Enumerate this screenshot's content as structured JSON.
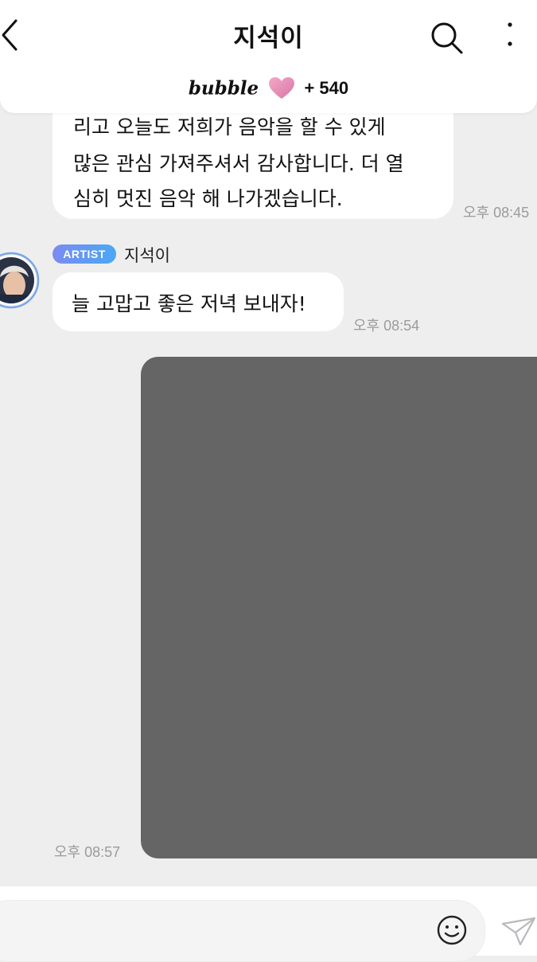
{
  "header": {
    "title": "지석이",
    "back_icon": "chevron-left-icon",
    "search_icon": "search-icon",
    "more_icon": "more-vertical-icon"
  },
  "bubble_bar": {
    "logo": "bubble",
    "heart_icon": "heart-icon",
    "count": "+ 540"
  },
  "messages": [
    {
      "lines": [
        "리고 오늘도 저희가 음악을 할 수 있게",
        "많은 관심 가져주셔서 감사합니다. 더 열",
        "심히 멋진 음악 해 나가겠습니다."
      ],
      "time": "오후 08:45"
    },
    {
      "sender_badge": "ARTIST",
      "sender": "지석이",
      "avatar_icon": "avatar",
      "text": "늘 고맙고 좋은 저녁 보내자!",
      "time": "오후 08:54"
    },
    {
      "type": "photo",
      "time": "오후 08:57"
    }
  ],
  "composer": {
    "input_value": "",
    "emoji_icon": "smile-icon",
    "send_icon": "send-icon"
  },
  "colors": {
    "background": "#eeeeef",
    "bubble": "#ffffff",
    "photo_placeholder": "#656565",
    "badge_gradient_start": "#7b8af2",
    "badge_gradient_end": "#4aa8f3",
    "timestamp": "#9b9b9b",
    "heart": "#e58ab4"
  }
}
